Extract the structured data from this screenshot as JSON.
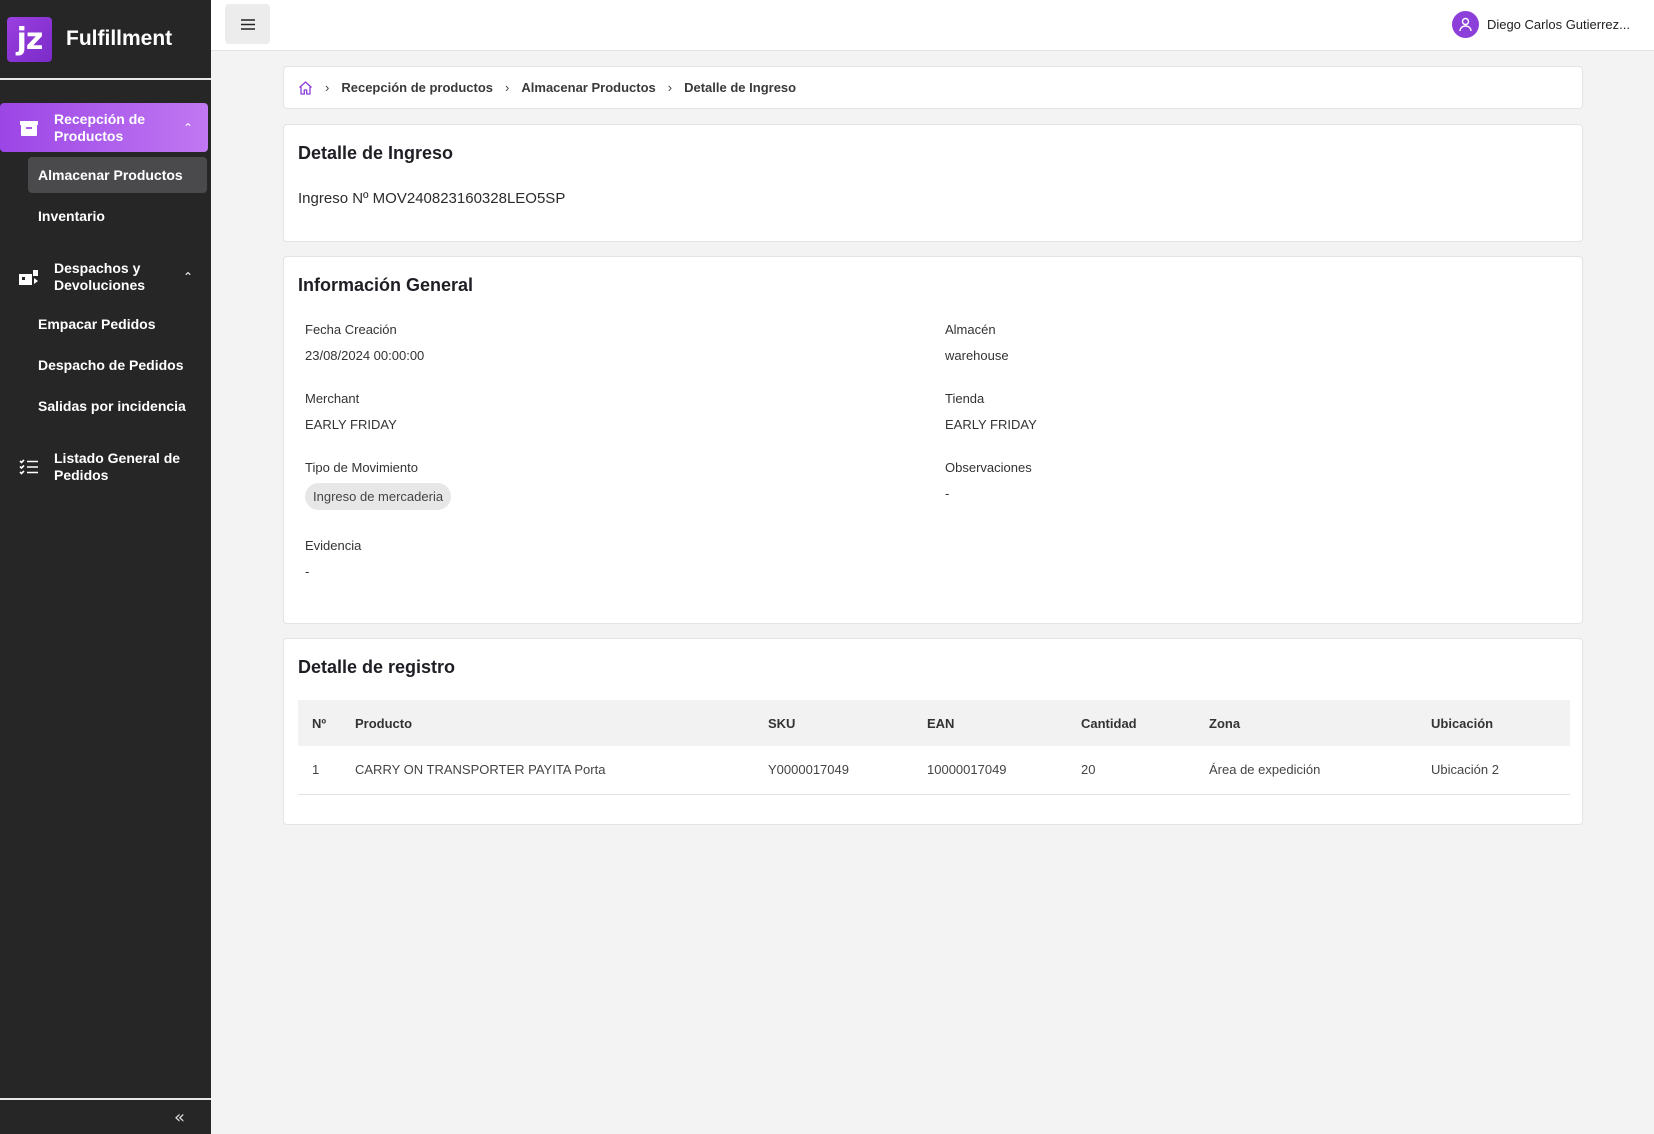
{
  "brand": {
    "logo_text": "jz",
    "name": "Fulfillment",
    "accent": "#9b45e6"
  },
  "sidebar": {
    "groups": [
      {
        "label": "Recepción de Productos",
        "icon": "box-icon",
        "items": [
          "Almacenar Productos",
          "Inventario"
        ]
      },
      {
        "label": "Despachos y Devoluciones",
        "icon": "dispatch-icon",
        "items": [
          "Empacar Pedidos",
          "Despacho de Pedidos",
          "Salidas por incidencia"
        ]
      },
      {
        "label": "Listado General de Pedidos",
        "icon": "list-icon",
        "items": []
      }
    ],
    "collapse_glyph": "«"
  },
  "topbar": {
    "user_name": "Diego Carlos Gutierrez..."
  },
  "breadcrumb": [
    "Recepción de productos",
    "Almacenar Productos",
    "Detalle de Ingreso"
  ],
  "ingreso": {
    "title": "Detalle de Ingreso",
    "number": "Ingreso Nº MOV240823160328LEO5SP"
  },
  "info": {
    "title": "Información General",
    "fecha_label": "Fecha Creación",
    "fecha_value": "23/08/2024 00:00:00",
    "almacen_label": "Almacén",
    "almacen_value": "warehouse",
    "merchant_label": "Merchant",
    "merchant_value": "EARLY FRIDAY",
    "tienda_label": "Tienda",
    "tienda_value": "EARLY FRIDAY",
    "tipo_label": "Tipo de Movimiento",
    "tipo_value": "Ingreso de mercaderia",
    "obs_label": "Observaciones",
    "obs_value": "-",
    "evidencia_label": "Evidencia",
    "evidencia_value": "-"
  },
  "registro": {
    "title": "Detalle de registro",
    "columns": [
      "Nº",
      "Producto",
      "SKU",
      "EAN",
      "Cantidad",
      "Zona",
      "Ubicación"
    ],
    "rows": [
      [
        "1",
        "CARRY ON TRANSPORTER PAYITA Porta",
        "Y0000017049",
        "10000017049",
        "20",
        "Área de expedición",
        "Ubicación 2"
      ]
    ]
  }
}
